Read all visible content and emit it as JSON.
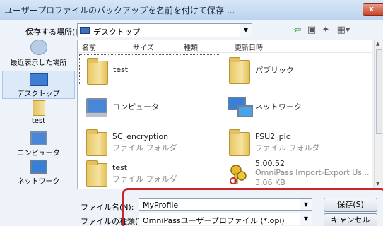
{
  "window": {
    "title": "ユーザープロファイルのバックアップを名前を付けて保存 ...",
    "close_label": "x",
    "accent": "#c8262c"
  },
  "save_in": {
    "label": "保存する場所(I):",
    "value": "デスクトップ"
  },
  "places": [
    {
      "label": "最近表示した場所",
      "icon": "recent-places-icon"
    },
    {
      "label": "デスクトップ",
      "icon": "desktop-icon"
    },
    {
      "label": "test",
      "icon": "user-folder-icon"
    },
    {
      "label": "コンピュータ",
      "icon": "computer-icon"
    },
    {
      "label": "ネットワーク",
      "icon": "network-icon"
    }
  ],
  "columns": [
    "名前",
    "サイズ",
    "種類",
    "更新日時"
  ],
  "items": [
    {
      "name": "test",
      "sub": "",
      "icon": "user-folder-icon"
    },
    {
      "name": "パブリック",
      "sub": "",
      "icon": "folder-icon"
    },
    {
      "name": "コンピュータ",
      "sub": "",
      "icon": "computer-icon"
    },
    {
      "name": "ネットワーク",
      "sub": "",
      "icon": "network-icon"
    },
    {
      "name": "5C_encryption",
      "sub": "ファイル フォルダ",
      "icon": "folder-icon"
    },
    {
      "name": "FSU2_pic",
      "sub": "ファイル フォルダ",
      "icon": "folder-icon"
    },
    {
      "name": "test",
      "sub": "ファイル フォルダ",
      "icon": "folder-icon"
    },
    {
      "name": "5.00.52",
      "sub": "OmniPass Import-Export Us...",
      "sub2": "3.06 KB",
      "icon": "keys-file-icon"
    }
  ],
  "filename": {
    "label": "ファイル名(N):",
    "value": "MyProfile"
  },
  "filetype": {
    "label": "ファイルの種類(T",
    "value": "OmniPassユーザープロファイル (*.opi)"
  },
  "buttons": {
    "save": "保存(S)",
    "cancel": "キャンセル"
  }
}
